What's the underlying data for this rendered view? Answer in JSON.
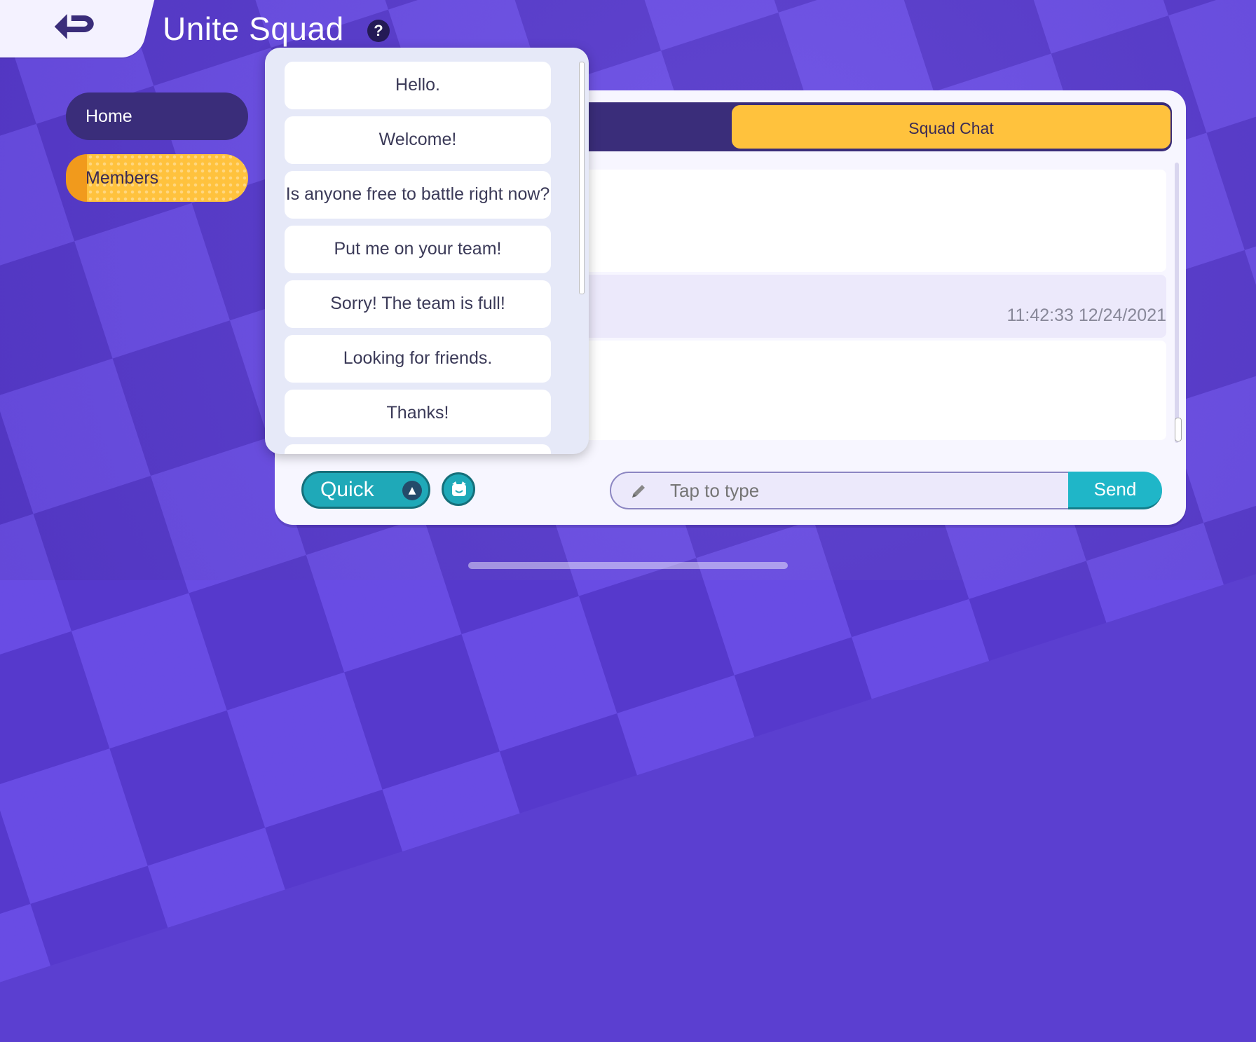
{
  "header": {
    "title": "Unite Squad",
    "help_icon": "question-mark-icon"
  },
  "sidebar": {
    "items": [
      {
        "label": "Home"
      },
      {
        "label": "Members"
      }
    ]
  },
  "chat": {
    "tab_label": "Squad Chat",
    "timestamp": "11:42:33 12/24/2021",
    "input_placeholder": "Tap to type",
    "send_label": "Send",
    "quick_label": "Quick"
  },
  "quick_messages": [
    "Hello.",
    "Welcome!",
    "Is anyone free to battle right now?",
    "Put me on your team!",
    "Sorry! The team is full!",
    "Looking for friends.",
    "Thanks!"
  ],
  "colors": {
    "accent": "#ffc23d",
    "teal": "#1fa9b8",
    "dark": "#3a2d7a"
  }
}
